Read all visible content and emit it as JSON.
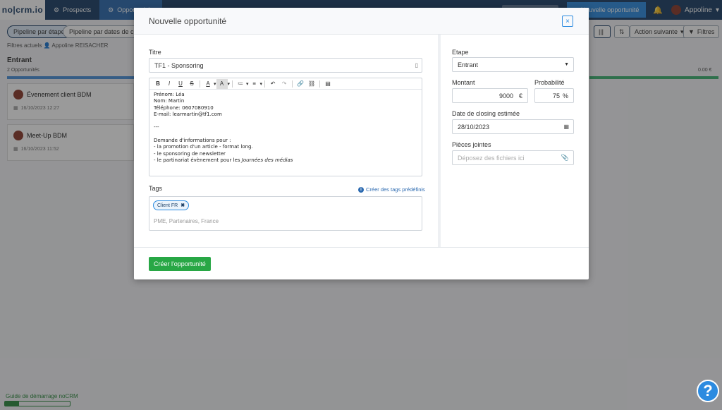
{
  "app": {
    "logo": "no|crm.io",
    "nav": [
      {
        "label": "Prospects",
        "icon": "gear-icon"
      },
      {
        "label": "Opportunités",
        "icon": "gear-icon"
      }
    ],
    "new_opportunity_label": "Nouvelle opportunité",
    "user_name": "Appoline"
  },
  "toolbar": {
    "pipeline_stage": "Pipeline par étape",
    "pipeline_closing": "Pipeline par dates de clos",
    "next_action": "Action suivante",
    "filters": "Filtres"
  },
  "filters_line": {
    "label": "Filtres actuels",
    "user": "Appoline REISACHER"
  },
  "column": {
    "title": "Entrant",
    "count": "2 Opportunités",
    "amount": "0.00 €"
  },
  "cards": [
    {
      "title": "Évenement client BDM",
      "date": "16/10/2023 12:27"
    },
    {
      "title": "Meet-Up BDM",
      "date": "16/10/2023 11:52"
    }
  ],
  "guide": {
    "label": "Guide de démarrage noCRM",
    "progress": 0.22
  },
  "help_label": "?",
  "modal": {
    "title": "Nouvelle opportunité",
    "close_label": "×",
    "titre_label": "Titre",
    "titre_value": "TF1 - Sponsoring",
    "editor_toolbar": [
      "B",
      "I",
      "U",
      "S",
      "A",
      "A",
      "≔",
      "≡",
      "↶",
      "↷",
      "🔗",
      "⛓",
      "▤"
    ],
    "description_lines": [
      "Prénom: Léa",
      "Nom: Martin",
      "Téléphone: 0607080910",
      "E-mail: learmartin@tf1.com",
      "",
      "---",
      "",
      "Demande d'informations pour :",
      "- la promotion d'un article - format long.",
      "- le sponsoring de newsletter"
    ],
    "description_last_prefix": "- le partinariat évènement pour les ",
    "description_last_italic": "Journées des médias",
    "tags_label": "Tags",
    "tags_link": "Créer des tags prédéfinis",
    "tags": [
      "Client FR"
    ],
    "tags_placeholder": "PME, Partenaires, France",
    "etape_label": "Etape",
    "etape_value": "Entrant",
    "montant_label": "Montant",
    "montant_value": "9000",
    "currency": "€",
    "probabilite_label": "Probabilité",
    "probabilite_value": "75",
    "percent": "%",
    "closing_label": "Date de closing estimée",
    "closing_value": "28/10/2023",
    "pieces_label": "Pièces jointes",
    "pieces_placeholder": "Déposez des fichiers ici",
    "create_button": "Créer l'opportunité"
  }
}
